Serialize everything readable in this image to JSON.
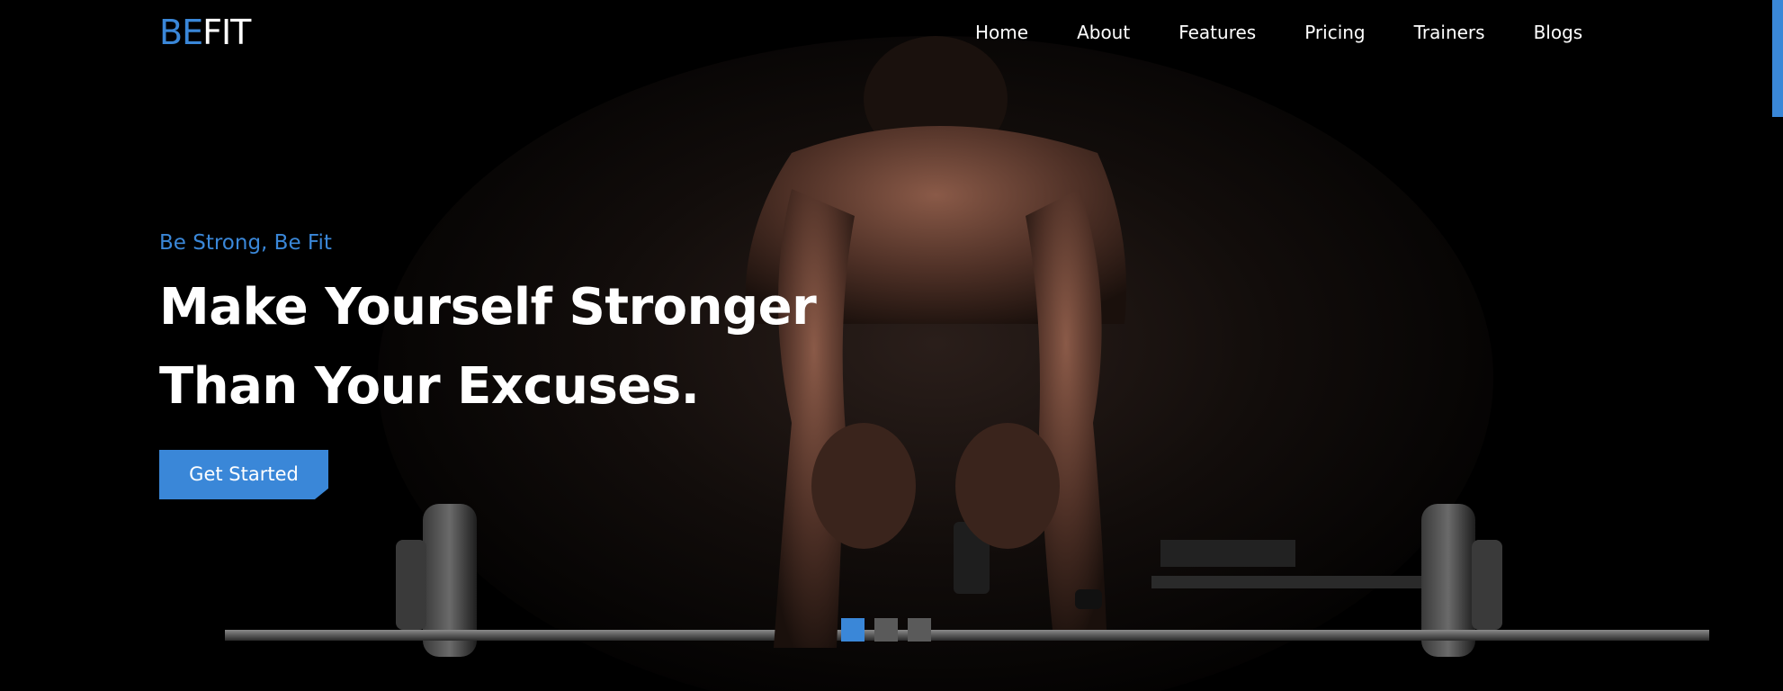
{
  "brand": {
    "logo_part1": "BE",
    "logo_part2": "FIT"
  },
  "nav": {
    "items": [
      {
        "label": "Home"
      },
      {
        "label": "About"
      },
      {
        "label": "Features"
      },
      {
        "label": "Pricing"
      },
      {
        "label": "Trainers"
      },
      {
        "label": "Blogs"
      }
    ]
  },
  "hero": {
    "tagline": "Be Strong, Be Fit",
    "headline_line1": "Make Yourself Stronger",
    "headline_line2": "Than Your Excuses.",
    "cta_label": "Get Started",
    "slider": {
      "total_slides": 3,
      "active_slide": 1
    }
  },
  "colors": {
    "accent": "#3a87d8",
    "background": "#000000",
    "text": "#ffffff",
    "inactive_dot": "#5a5a5a"
  }
}
